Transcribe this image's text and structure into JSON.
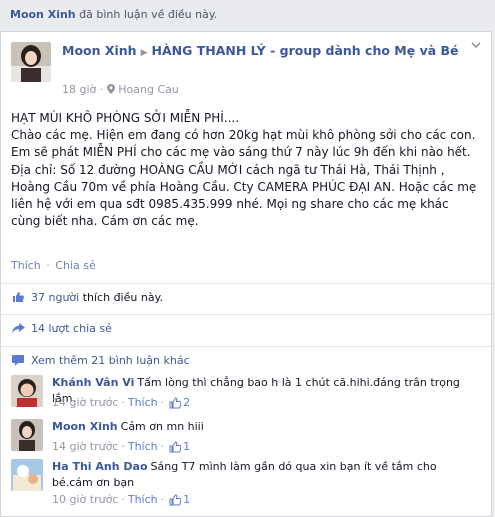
{
  "story": {
    "author": "Moon Xinh",
    "action": "đã bình luận về điều này."
  },
  "post": {
    "author": "Moon Xinh",
    "group": "HÀNG THANH LÝ - group dành cho Mẹ và Bé",
    "time": "18 giờ",
    "location": "Hoang Cau",
    "body": "HẠT MÙI KHÔ PHÒNG SỞI MIỄN PHÍ....\nChào các mẹ. Hiện em đang có hơn 20kg hạt mùi khô phòng sởi cho các con. Em sẽ phát MIỄN PHÍ cho các mẹ vào sáng thứ 7 này lúc 9h đến khi nào hết. Địa chỉ: Số 12 đường HOÀNG CẦU MỚI cách ngã tư Thái Hà, Thái Thịnh , Hoàng Cầu 70m về phía Hoàng Cầu. Cty CAMERA PHÚC ĐẠI AN. Hoặc các mẹ liên hệ với em qua sđt 0985.435.999 nhé. Mọi ng share cho các mẹ khác cùng biết nha. Cám ơn các mẹ.",
    "like_action": "Thích",
    "share_action": "Chia sẻ",
    "separator": "·"
  },
  "summary": {
    "likes_link": "37 người",
    "likes_suffix": "thích điều này.",
    "shares": "14 lượt chia sẻ",
    "more_comments": "Xem thêm 21 bình luận khác"
  },
  "comments": [
    {
      "author": "Khánh Vân Vi",
      "text": "Tấm lòng thì chẳng bao h là 1 chút cã.hihi.đáng trân trọng lắm.",
      "time": "14 giờ trước",
      "like": "Thích",
      "likes": "2"
    },
    {
      "author": "Moon Xinh",
      "text": "Cảm ơn mn hiii",
      "time": "14 giờ trước",
      "like": "Thích",
      "likes": "1"
    },
    {
      "author": "Ha Thi Anh Dao",
      "text": "Sáng T7 mình làm gần dó qua xin bạn ít về tắm cho bé.cám ơn bạn",
      "time": "10 giờ trước",
      "like": "Thích",
      "likes": "1"
    }
  ],
  "icons": {
    "thumbs_up": "thumbs-up-icon",
    "share": "share-icon",
    "comment": "comment-icon",
    "location": "location-pin-icon",
    "menu": "chevron-down-icon"
  },
  "colors": {
    "link": "#3b5998",
    "meta": "#9197a3",
    "like_blue": "#5b7bd5"
  }
}
